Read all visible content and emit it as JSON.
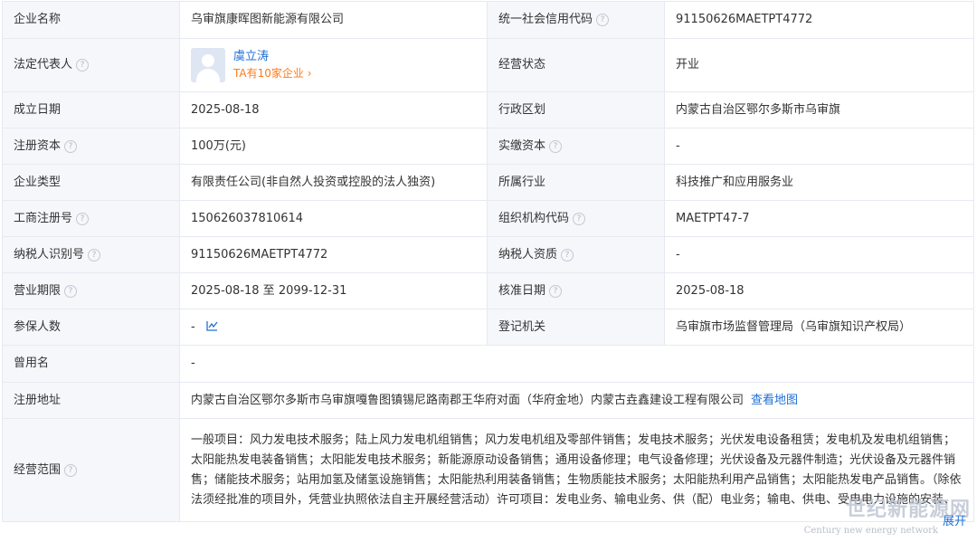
{
  "rows": {
    "company_name": {
      "label": "企业名称",
      "value": "乌审旗康晖图新能源有限公司"
    },
    "credit_code": {
      "label": "统一社会信用代码",
      "value": "91150626MAETPT4772"
    },
    "legal_rep": {
      "label": "法定代表人",
      "name": "虞立涛",
      "companies": "TA有10家企业 ›"
    },
    "biz_status": {
      "label": "经营状态",
      "value": "开业"
    },
    "est_date": {
      "label": "成立日期",
      "value": "2025-08-18"
    },
    "district": {
      "label": "行政区划",
      "value": "内蒙古自治区鄂尔多斯市乌审旗"
    },
    "reg_capital": {
      "label": "注册资本",
      "value": "100万(元)"
    },
    "paid_capital": {
      "label": "实缴资本",
      "value": "-"
    },
    "company_type": {
      "label": "企业类型",
      "value": "有限责任公司(非自然人投资或控股的法人独资)"
    },
    "industry": {
      "label": "所属行业",
      "value": "科技推广和应用服务业"
    },
    "reg_number": {
      "label": "工商注册号",
      "value": "150626037810614"
    },
    "org_code": {
      "label": "组织机构代码",
      "value": "MAETPT47-7"
    },
    "taxpayer_id": {
      "label": "纳税人识别号",
      "value": "91150626MAETPT4772"
    },
    "taxpayer_qual": {
      "label": "纳税人资质",
      "value": "-"
    },
    "biz_term": {
      "label": "营业期限",
      "value": "2025-08-18 至 2099-12-31"
    },
    "approval_date": {
      "label": "核准日期",
      "value": "2025-08-18"
    },
    "insured": {
      "label": "参保人数",
      "value": "-"
    },
    "reg_authority": {
      "label": "登记机关",
      "value": "乌审旗市场监督管理局（乌审旗知识产权局）"
    },
    "former_name": {
      "label": "曾用名",
      "value": "-"
    },
    "reg_address": {
      "label": "注册地址",
      "value": "内蒙古自治区鄂尔多斯市乌审旗嘎鲁图镇锡尼路南郡王华府对面（华府金地）内蒙古垚鑫建设工程有限公司",
      "link": "查看地图"
    },
    "biz_scope": {
      "label": "经营范围",
      "value": "一般项目：风力发电技术服务；陆上风力发电机组销售；风力发电机组及零部件销售；发电技术服务；光伏发电设备租赁；发电机及发电机组销售；太阳能热发电装备销售；太阳能发电技术服务；新能源原动设备销售；通用设备修理；电气设备修理；光伏设备及元器件制造；光伏设备及元器件销售；储能技术服务；站用加氢及储氢设施销售；太阳能热利用装备销售；生物质能技术服务；太阳能热利用产品销售；太阳能热发电产品销售。（除依法须经批准的项目外，凭营业执照依法自主开展经营活动）许可项目：发电业务、输电业务、供（配）电业务；输电、供电、受电电力设施的安装、维修和试验。（依法须经批准的项目，经相关部门批准后方可开展经营活动，具体经营项目以相关部门批准文件或许可证件为准）",
      "expand": "展开"
    }
  },
  "help_glyph": "?",
  "watermark": {
    "cn": "世纪新能源网",
    "en": "Century new energy network"
  },
  "colors": {
    "label_bg": "#f5f7fb",
    "border": "#e6eaf1",
    "link": "#1f6fd6",
    "orange": "#ff7a1a"
  }
}
